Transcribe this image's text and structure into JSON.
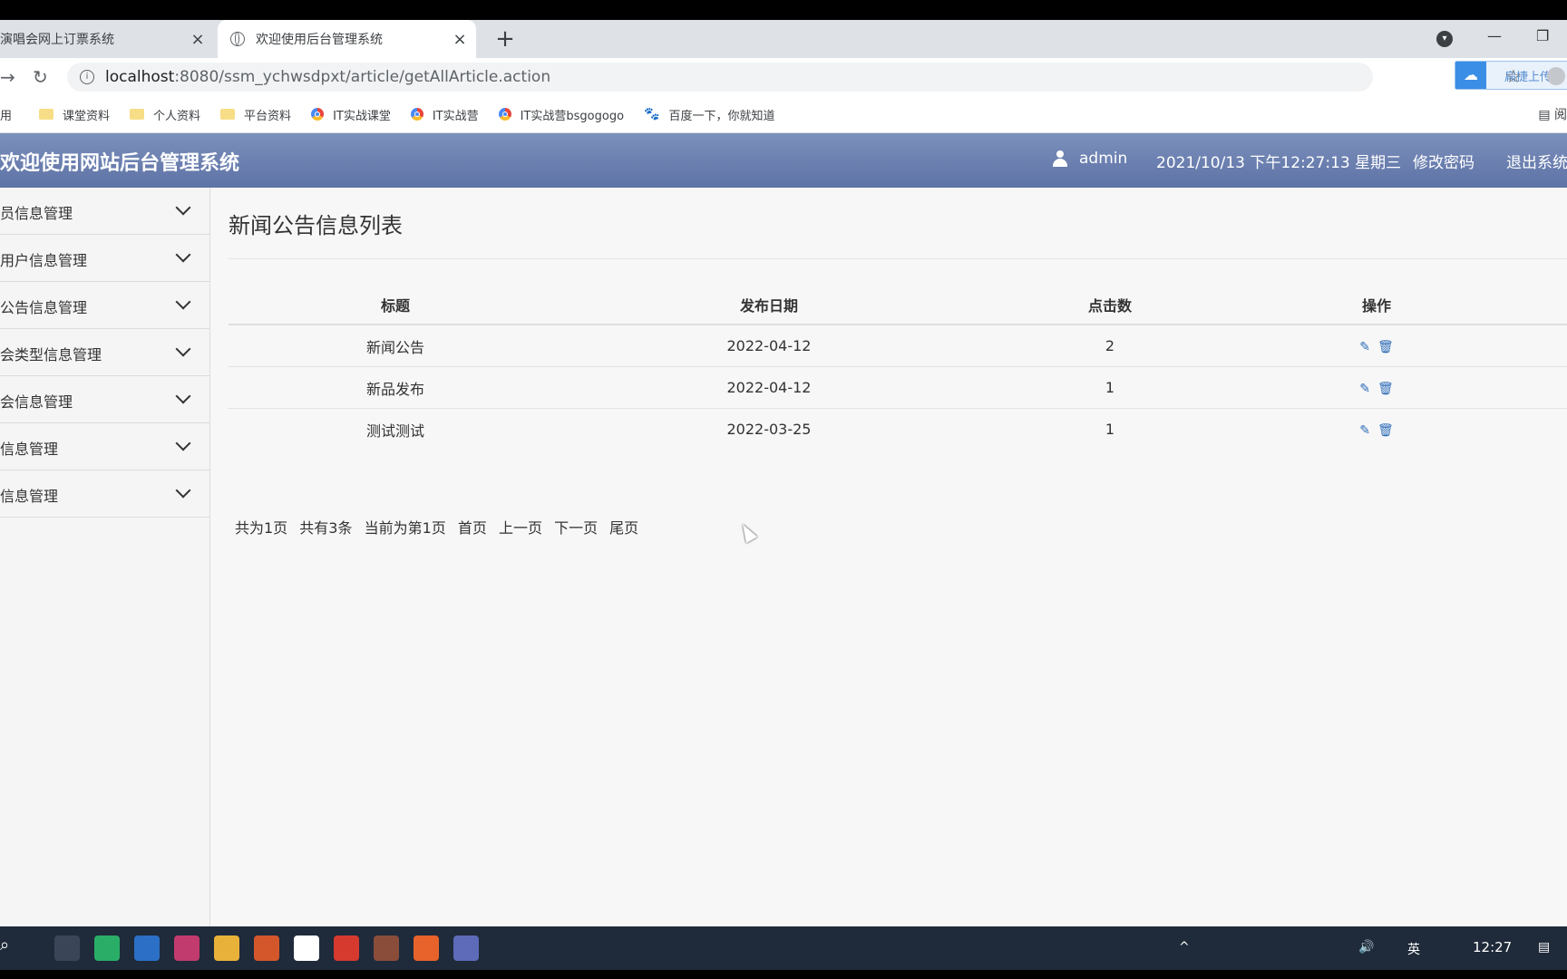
{
  "browser": {
    "tabs": [
      {
        "title": "演唱会网上订票系统",
        "close": "×"
      },
      {
        "title": "欢迎使用后台管理系统",
        "close": "×"
      }
    ],
    "new_tab": "+",
    "url_host": "localhost",
    "url_rest": ":8080/ssm_ychwsdpxt/article/getAllArticle.action",
    "cloud_button": "扁捷上传",
    "bookmarks": [
      {
        "label": "用",
        "icon": "none"
      },
      {
        "label": "课堂资料",
        "icon": "folder-icon"
      },
      {
        "label": "个人资料",
        "icon": "folder-icon"
      },
      {
        "label": "平台资料",
        "icon": "folder-icon"
      },
      {
        "label": "IT实战课堂",
        "icon": "chrome-icon"
      },
      {
        "label": "IT实战营",
        "icon": "chrome-icon"
      },
      {
        "label": "IT实战营bsgogogo",
        "icon": "chrome-icon"
      },
      {
        "label": "百度一下，你就知道",
        "icon": "baidu-paw-icon"
      }
    ],
    "reader": "阅"
  },
  "header": {
    "title": "欢迎使用网站后台管理系统",
    "user": "admin",
    "datetime": "2021/10/13 下午12:27:13 星期三",
    "change_password": "修改密码",
    "logout": "退出系统"
  },
  "sidebar": {
    "items": [
      {
        "label": "员信息管理"
      },
      {
        "label": "用户信息管理"
      },
      {
        "label": "公告信息管理"
      },
      {
        "label": "会类型信息管理"
      },
      {
        "label": "会信息管理"
      },
      {
        "label": "信息管理"
      },
      {
        "label": "信息管理"
      }
    ]
  },
  "main": {
    "page_title": "新闻公告信息列表",
    "columns": [
      "标题",
      "发布日期",
      "点击数",
      "操作"
    ],
    "rows": [
      {
        "title": "新闻公告",
        "date": "2022-04-12",
        "clicks": "2"
      },
      {
        "title": "新品发布",
        "date": "2022-04-12",
        "clicks": "1"
      },
      {
        "title": "测试测试",
        "date": "2022-03-25",
        "clicks": "1"
      }
    ],
    "pager": {
      "total_pages": "共为1页",
      "total_items": "共有3条",
      "current": "当前为第1页",
      "first": "首页",
      "prev": "上一页",
      "next": "下一页",
      "last": "尾页"
    }
  },
  "taskbar": {
    "ime": "英",
    "time": "12:27"
  }
}
